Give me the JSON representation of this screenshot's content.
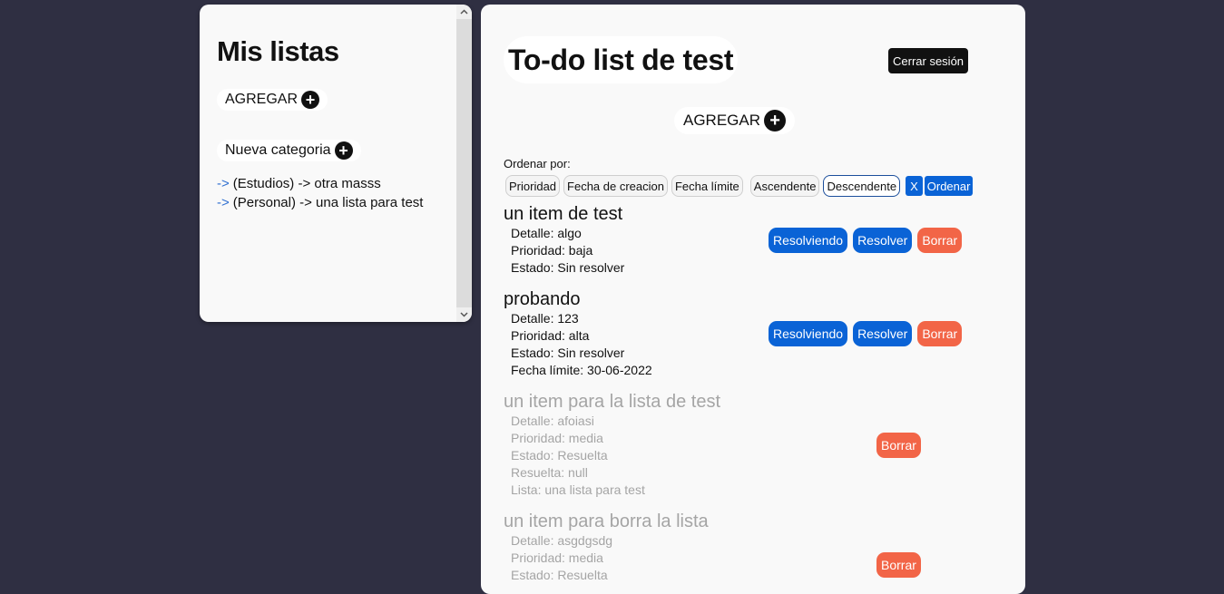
{
  "sidebar": {
    "title": "Mis listas",
    "add_label": "AGREGAR",
    "new_category_label": "Nueva categoria",
    "lists": [
      {
        "arrow": "->",
        "label": "(Estudios) -> otra masss"
      },
      {
        "arrow": "->",
        "label": "(Personal) -> una lista para test"
      }
    ]
  },
  "main": {
    "title": "To-do list de test",
    "logout_label": "Cerrar sesión",
    "add_label": "AGREGAR",
    "sort": {
      "label": "Ordenar por:",
      "options": [
        "Prioridad",
        "Fecha de creacion",
        "Fecha límite",
        "Ascendente",
        "Descendente"
      ],
      "selected": "Descendente",
      "clear_label": "X",
      "apply_label": "Ordenar"
    },
    "tasks": [
      {
        "title": "un item de test",
        "details": [
          "Detalle: algo",
          "Prioridad: baja",
          "Estado: Sin resolver"
        ],
        "resolving_label": "Resolviendo",
        "resolve_label": "Resolver",
        "delete_label": "Borrar"
      },
      {
        "title": "probando",
        "details": [
          "Detalle: 123",
          "Prioridad: alta",
          "Estado: Sin resolver",
          "Fecha límite: 30-06-2022"
        ],
        "resolving_label": "Resolviendo",
        "resolve_label": "Resolver",
        "delete_label": "Borrar"
      },
      {
        "title": "un item para la lista de test",
        "details": [
          "Detalle: afoiasi",
          "Prioridad: media",
          "Estado: Resuelta",
          "Resuelta: null",
          "Lista: una lista para test"
        ],
        "delete_label": "Borrar"
      },
      {
        "title": "un item para borra la lista",
        "details": [
          "Detalle: asgdgsdg",
          "Prioridad: media",
          "Estado: Resuelta"
        ],
        "delete_label": "Borrar"
      }
    ]
  },
  "colors": {
    "background": "#2f2f42",
    "panel": "#f9f9f9",
    "primary_button": "#0a63d6",
    "delete_button": "#f26547",
    "resolved_text": "#a5a5a5"
  }
}
